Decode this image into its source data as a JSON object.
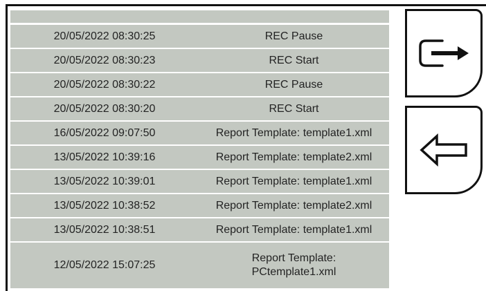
{
  "log": {
    "rows": [
      {
        "date": "",
        "message": ""
      },
      {
        "date": "20/05/2022 08:30:25",
        "message": "REC Pause"
      },
      {
        "date": "20/05/2022 08:30:23",
        "message": "REC Start"
      },
      {
        "date": "20/05/2022 08:30:22",
        "message": "REC Pause"
      },
      {
        "date": "20/05/2022 08:30:20",
        "message": "REC Start"
      },
      {
        "date": "16/05/2022 09:07:50",
        "message": "Report Template: template1.xml"
      },
      {
        "date": "13/05/2022 10:39:16",
        "message": "Report Template: template2.xml"
      },
      {
        "date": "13/05/2022 10:39:01",
        "message": "Report Template: template1.xml"
      },
      {
        "date": "13/05/2022 10:38:52",
        "message": "Report Template: template2.xml"
      },
      {
        "date": "13/05/2022 10:38:51",
        "message": "Report Template: template1.xml"
      },
      {
        "date": "12/05/2022 15:07:25",
        "message": "Report Template:\nPCtemplate1.xml"
      }
    ]
  },
  "buttons": {
    "exit_icon": "exit-arrow-icon",
    "back_icon": "back-arrow-icon"
  },
  "colors": {
    "row_bg": "#c3c8c1",
    "text": "#232323",
    "border": "#111111"
  }
}
